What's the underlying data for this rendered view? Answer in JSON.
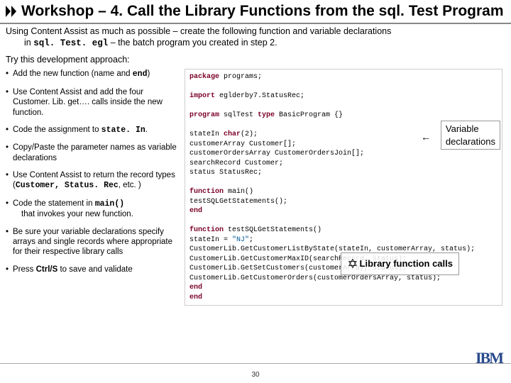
{
  "header": {
    "title": "Workshop – 4. Call the Library Functions from the sql. Test Program"
  },
  "intro": {
    "line1": "Using Content Assist as much as possible – create the following function and variable declarations",
    "line2a": "in ",
    "line2_mono": "sql. Test. egl",
    "line2b": " – the batch program you created in step 2."
  },
  "try": "Try this development approach:",
  "bullets": {
    "b1a": "Add the new function (name and ",
    "b1_mono": "end",
    "b1b": ")",
    "b2": "Use Content Assist and add the four Customer. Lib. get…. calls inside the new function.",
    "b3a": "Code the assignment to ",
    "b3_mono": "state. In",
    "b3b": ".",
    "b4": "Copy/Paste the parameter names as variable declarations",
    "b5a": "Use Content Assist to return the record types (",
    "b5_mono1": "Customer,",
    "b5_mono2": " Status. Rec",
    "b5b": ", etc. )",
    "b6a": "Code the statement in ",
    "b6_mono": "main()",
    "b6b": "that invokes your new function.",
    "b7": "Be sure your variable declarations specify arrays and single records where appropriate for their respective library calls",
    "b8a": "Press ",
    "b8_mono": "Ctrl/S",
    "b8b": " to save and validate"
  },
  "code": {
    "l1a": "package",
    "l1b": " programs;",
    "l2a": "import",
    "l2b": " eglderby7.StatusRec;",
    "l3a": "program",
    "l3b": " sqlTest ",
    "l3c": "type",
    "l3d": " BasicProgram {}",
    "l4a": "  stateIn          ",
    "l4b": "char",
    "l4c": "(2);",
    "l5a": "  customerArray    Customer[];",
    "l6a": "  customerOrdersArray CustomerOrdersJoin[];",
    "l7a": "  searchRecord     Customer;",
    "l8a": "  status           StatusRec;",
    "l9a": "  function",
    "l9b": " main()",
    "l10": "    testSQLGetStatements();",
    "l11": "  end",
    "l12a": "  function",
    "l12b": " testSQLGetStatements()",
    "l13a": "    stateIn = ",
    "l13b": "\"NJ\"",
    "l13c": ";",
    "l14": "    CustomerLib.GetCustomerListByState(stateIn, customerArray, status);",
    "l15": "    CustomerLib.GetCustomerMaxID(searchRecord, status);",
    "l16": "    CustomerLib.GetSetCustomers(customerArray, status);",
    "l17": "    CustomerLib.GetCustomerOrders(customerOrdersArray, status);",
    "l18": "  end",
    "l19": "end"
  },
  "annotations": {
    "var1": "Variable",
    "var2": "declarations",
    "lib": "Library function calls"
  },
  "footer": {
    "pagenum": "30",
    "logo": "IBM"
  }
}
